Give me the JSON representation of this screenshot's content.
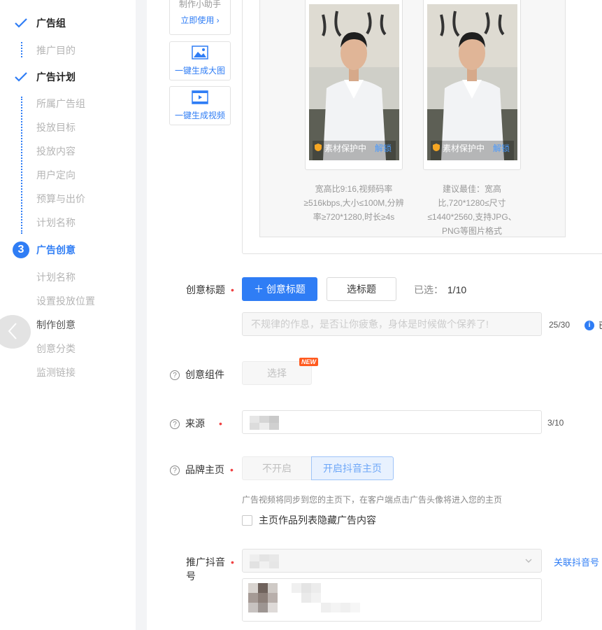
{
  "sidebar": {
    "step1": {
      "label": "广告组",
      "subs": [
        "推广目的"
      ]
    },
    "step2": {
      "label": "广告计划",
      "subs": [
        "所属广告组",
        "投放目标",
        "投放内容",
        "用户定向",
        "预算与出价",
        "计划名称"
      ]
    },
    "step3": {
      "number": "3",
      "label": "广告创意",
      "subs": [
        "计划名称",
        "设置投放位置",
        "制作创意",
        "创意分类",
        "监测链接"
      ]
    }
  },
  "tools": {
    "partial_text": "制作小助手",
    "use_now": "立即使用 ›",
    "gen_image": "一键生成大图",
    "gen_video": "一键生成视频"
  },
  "previews": [
    {
      "protect": "素材保护中",
      "unlock": "解锁",
      "hint": "宽高比9:16,视频码率≥516kbps,大小≤100M,分辨率≥720*1280,时长≥4s"
    },
    {
      "protect": "素材保护中",
      "unlock": "解锁",
      "hint": "建议最佳：宽高比,720*1280≤尺寸≤1440*2560,支持JPG、PNG等图片格式"
    }
  ],
  "form": {
    "title": {
      "label": "创意标题",
      "add_button": "＋ 创意标题",
      "select_button": "选标题",
      "selected_label": "已选：",
      "selected_value": "1/10",
      "input_text": "不规律的作息，是否让你疲惫，身体是时候做个保养了!",
      "counter": "25/30",
      "info_text": "已"
    },
    "component": {
      "label": "创意组件",
      "button": "选择",
      "badge": "NEW"
    },
    "source": {
      "label": "来源",
      "counter": "3/10"
    },
    "brand": {
      "label": "品牌主页",
      "off_button": "不开启",
      "on_button": "开启抖音主页",
      "note": "广告视频将同步到您的主页下，在客户端点击广告头像将进入您的主页",
      "checkbox_label": "主页作品列表隐藏广告内容"
    },
    "douyin": {
      "label_line1": "推广抖音",
      "label_line2": "号",
      "link": "关联抖音号"
    }
  },
  "colors": {
    "accent": "#2f7df5",
    "required": "#f04142",
    "badge": "#ff5a1f"
  }
}
